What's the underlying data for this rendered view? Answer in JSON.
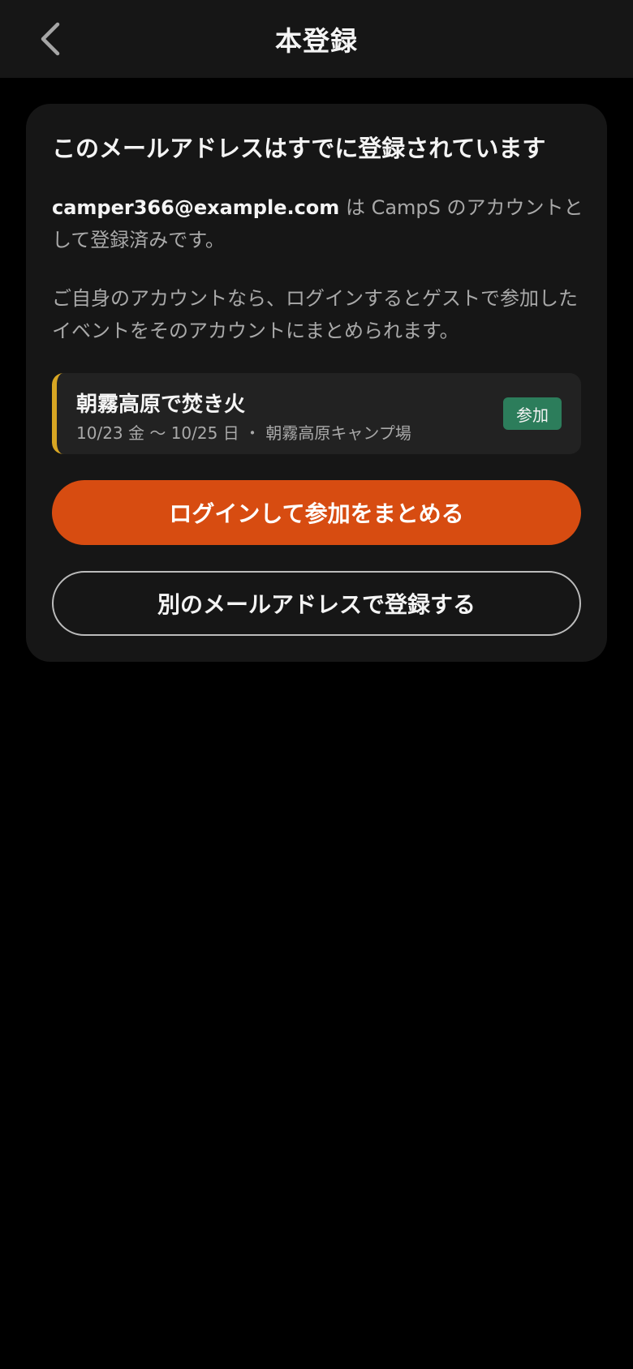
{
  "header": {
    "title": "本登録",
    "back_icon": "chevron-left-icon"
  },
  "card": {
    "heading": "このメールアドレスはすでに登録されています",
    "email": "camper366@example.com",
    "registered_text": " は CampS のアカウントとして登録済みです。",
    "login_hint": "ご自身のアカウントなら、ログインするとゲストで参加したイベントをそのアカウントにまとめられます。"
  },
  "event": {
    "title": "朝霧高原で焚き火",
    "meta": "10/23 金 〜 10/25 日 ・ 朝霧高原キャンプ場",
    "status": "参加",
    "accent_color": "#d8a623",
    "status_color": "#2c7d5b"
  },
  "actions": {
    "login_label": "ログインして参加をまとめる",
    "other_email_label": "別のメールアドレスで登録する",
    "primary_color": "#d74c11"
  }
}
